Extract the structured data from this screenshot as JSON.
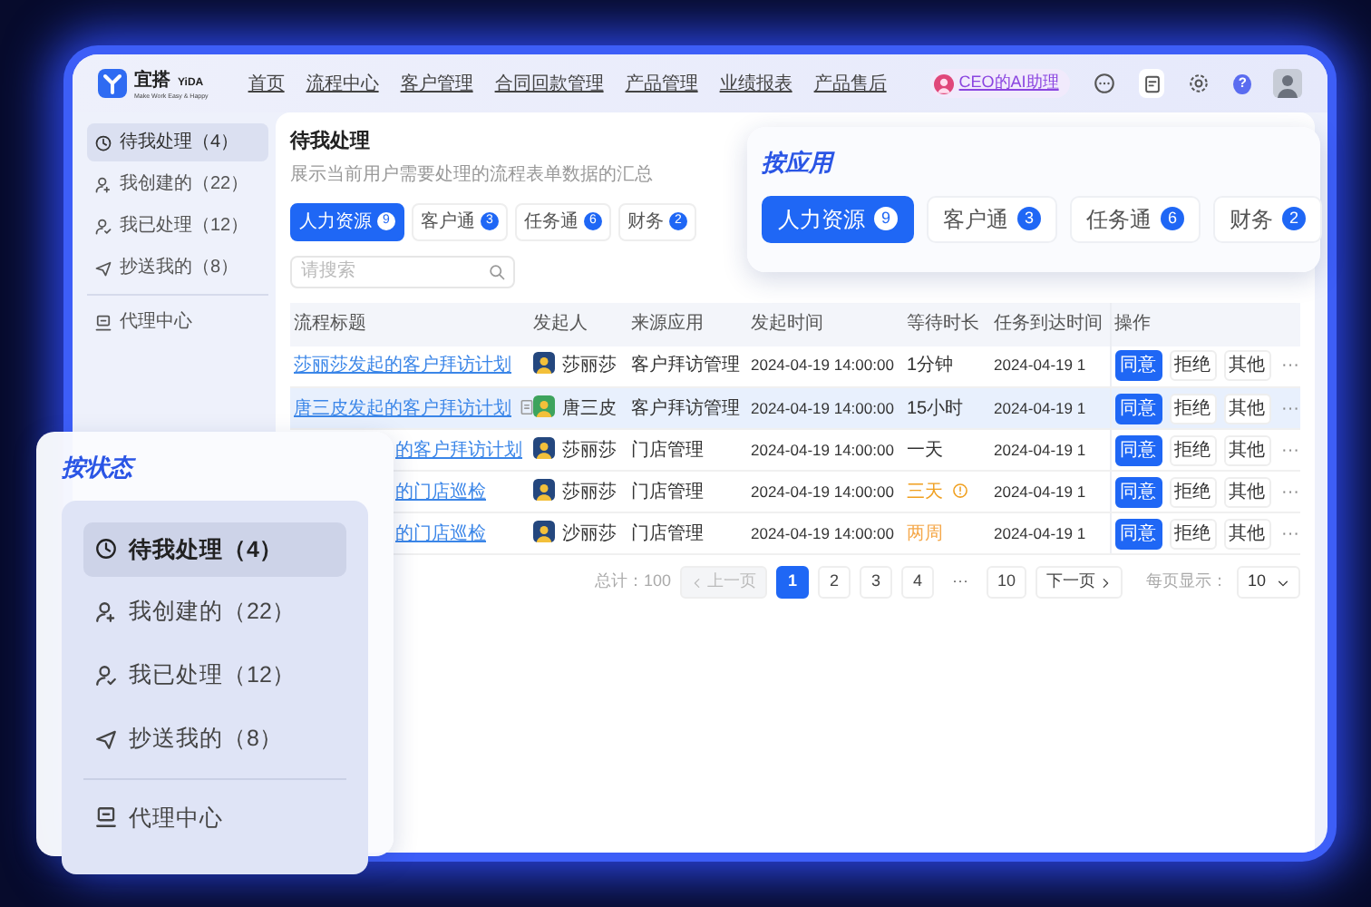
{
  "nav": {
    "logo_text": "宜搭",
    "logo_sub": "YiDA",
    "logo_tagline": "Make Work Easy & Happy",
    "items": [
      {
        "label": "首页"
      },
      {
        "label": "流程中心"
      },
      {
        "label": "客户管理"
      },
      {
        "label": "合同回款管理"
      },
      {
        "label": "产品管理"
      },
      {
        "label": "业绩报表"
      },
      {
        "label": "产品售后"
      }
    ],
    "ai_assistant": "CEO的AI助理",
    "help": "?"
  },
  "sidebar": {
    "items": [
      {
        "label": "待我处理（4）",
        "selected": true
      },
      {
        "label": "我创建的（22）",
        "selected": false
      },
      {
        "label": "我已处理（12）",
        "selected": false
      },
      {
        "label": "抄送我的（8）",
        "selected": false
      }
    ],
    "footer_items": [
      {
        "label": "代理中心",
        "selected": false
      }
    ]
  },
  "page": {
    "title": "待我处理",
    "description": "展示当前用户需要处理的流程表单数据的汇总",
    "tabs": [
      {
        "label": "人力资源",
        "count": "9",
        "selected": true
      },
      {
        "label": "客户通",
        "count": "3",
        "selected": false
      },
      {
        "label": "任务通",
        "count": "6",
        "selected": false
      },
      {
        "label": "财务",
        "count": "2",
        "selected": false
      }
    ],
    "search": {
      "placeholder": "请搜索"
    }
  },
  "table": {
    "columns": [
      "流程标题",
      "发起人",
      "来源应用",
      "发起时间",
      "等待时长",
      "任务到达时间",
      "操作"
    ],
    "rows": [
      {
        "title": "莎丽莎发起的客户拜访计划",
        "attachment": false,
        "partly_covered": false,
        "initiator": "莎丽莎",
        "avatar": {
          "color": "#24477e"
        },
        "app": "客户拜访管理",
        "start_time": "2024-04-19 14:00:00",
        "wait": "1分钟",
        "overdue": false,
        "warning_icon": false,
        "arrival": "2024-04-19 1",
        "selected": false,
        "actions": [
          {
            "label": "同意",
            "kind": "primary"
          },
          {
            "label": "拒绝",
            "kind": "plain"
          },
          {
            "label": "其他",
            "kind": "plain"
          },
          {
            "label": "···",
            "kind": "more"
          }
        ]
      },
      {
        "title": "唐三皮发起的客户拜访计划",
        "attachment": true,
        "partly_covered": false,
        "initiator": "唐三皮",
        "avatar": {
          "color": "#3da35d"
        },
        "app": "客户拜访管理",
        "start_time": "2024-04-19 14:00:00",
        "wait": "15小时",
        "overdue": false,
        "warning_icon": false,
        "arrival": "2024-04-19 1",
        "selected": true,
        "actions": [
          {
            "label": "同意",
            "kind": "primary"
          },
          {
            "label": "拒绝",
            "kind": "plain"
          },
          {
            "label": "其他",
            "kind": "plain"
          },
          {
            "label": "···",
            "kind": "more"
          }
        ]
      },
      {
        "title": "的客户拜访计划",
        "attachment": false,
        "partly_covered": true,
        "initiator": "莎丽莎",
        "avatar": {
          "color": "#24477e"
        },
        "app": "门店管理",
        "start_time": "2024-04-19 14:00:00",
        "wait": "一天",
        "overdue": false,
        "warning_icon": false,
        "arrival": "2024-04-19 1",
        "selected": false,
        "actions": [
          {
            "label": "同意",
            "kind": "primary"
          },
          {
            "label": "拒绝",
            "kind": "plain"
          },
          {
            "label": "其他",
            "kind": "plain"
          },
          {
            "label": "···",
            "kind": "more"
          }
        ]
      },
      {
        "title": "的门店巡检",
        "attachment": false,
        "partly_covered": true,
        "initiator": "莎丽莎",
        "avatar": {
          "color": "#24477e"
        },
        "app": "门店管理",
        "start_time": "2024-04-19 14:00:00",
        "wait": "三天",
        "overdue": true,
        "warning_icon": true,
        "arrival": "2024-04-19 1",
        "selected": false,
        "actions": [
          {
            "label": "同意",
            "kind": "primary"
          },
          {
            "label": "拒绝",
            "kind": "plain"
          },
          {
            "label": "其他",
            "kind": "plain"
          },
          {
            "label": "···",
            "kind": "more"
          }
        ]
      },
      {
        "title": "的门店巡检",
        "attachment": false,
        "partly_covered": true,
        "initiator": "沙丽莎",
        "avatar": {
          "color": "#24477e"
        },
        "app": "门店管理",
        "start_time": "2024-04-19 14:00:00",
        "wait": "两周",
        "overdue": true,
        "warning_icon": false,
        "arrival": "2024-04-19 1",
        "selected": false,
        "actions": [
          {
            "label": "同意",
            "kind": "primary"
          },
          {
            "label": "拒绝",
            "kind": "plain"
          },
          {
            "label": "其他",
            "kind": "plain"
          },
          {
            "label": "···",
            "kind": "more"
          }
        ]
      }
    ]
  },
  "pagination": {
    "total": "总计：100",
    "prev": {
      "label": "上一页",
      "disabled": true
    },
    "pages": [
      {
        "label": "1",
        "kind": "page",
        "selected": true
      },
      {
        "label": "2",
        "kind": "page",
        "selected": false
      },
      {
        "label": "3",
        "kind": "page",
        "selected": false
      },
      {
        "label": "4",
        "kind": "page",
        "selected": false
      },
      {
        "label": "···",
        "kind": "ellipsis"
      },
      {
        "label": "10",
        "kind": "page",
        "selected": false
      }
    ],
    "next": {
      "label": "下一页",
      "disabled": false
    },
    "per_page_label": "每页显示：",
    "per_page": "10"
  },
  "app_callout": {
    "title": "按应用",
    "tabs": [
      {
        "label": "人力资源",
        "count": "9",
        "selected": true
      },
      {
        "label": "客户通",
        "count": "3",
        "selected": false
      },
      {
        "label": "任务通",
        "count": "6",
        "selected": false
      },
      {
        "label": "财务",
        "count": "2",
        "selected": false
      }
    ]
  },
  "status_callout": {
    "title": "按状态",
    "items": [
      {
        "label": "待我处理（4）",
        "selected": true
      },
      {
        "label": "我创建的（22）",
        "selected": false
      },
      {
        "label": "我已处理（12）",
        "selected": false
      },
      {
        "label": "抄送我的（8）",
        "selected": false
      }
    ],
    "footer_items": [
      {
        "label": "代理中心",
        "selected": false
      }
    ]
  }
}
